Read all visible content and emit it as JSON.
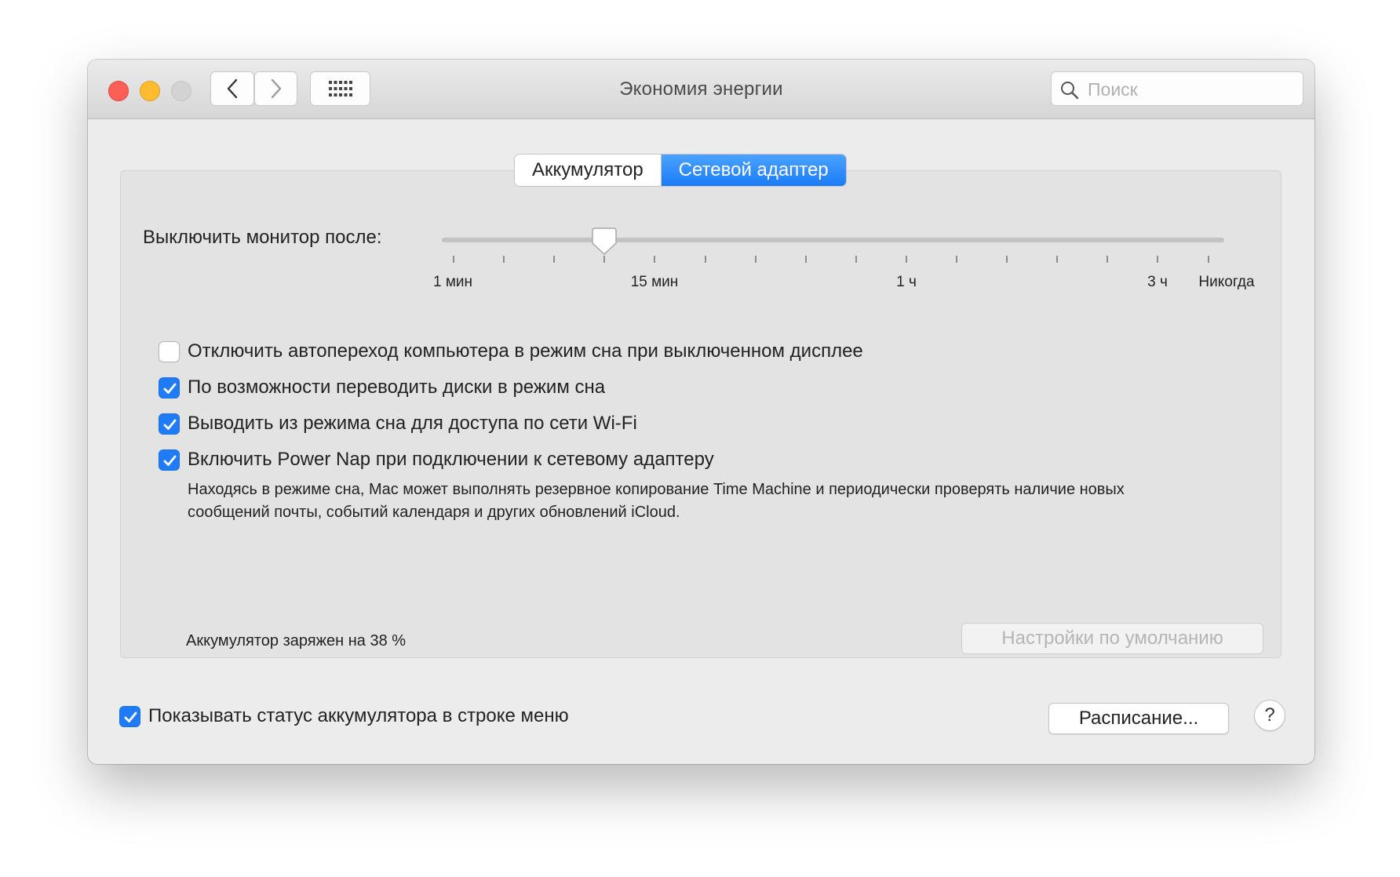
{
  "window": {
    "title": "Экономия энергии",
    "search_placeholder": "Поиск"
  },
  "tabs": [
    {
      "label": "Аккумулятор",
      "active": false
    },
    {
      "label": "Сетевой адаптер",
      "active": true
    }
  ],
  "slider": {
    "label": "Выключить монитор после:",
    "tick_labels": [
      "1 мин",
      "15 мин",
      "1 ч",
      "3 ч",
      "Никогда"
    ],
    "tick_count": 16,
    "value_fraction": 0.21
  },
  "options": [
    {
      "label": "Отключить автопереход компьютера в режим сна при выключенном дисплее",
      "checked": false
    },
    {
      "label": "По возможности переводить диски в режим сна",
      "checked": true
    },
    {
      "label": "Выводить из режима сна для доступа по сети Wi-Fi",
      "checked": true
    },
    {
      "label": "Включить Power Nap при подключении к сетевому адаптеру",
      "checked": true
    }
  ],
  "power_nap_description": "Находясь в режиме сна, Mac может выполнять резервное копирование Time Machine и периодически проверять наличие новых сообщений почты, событий календаря и других обновлений iCloud.",
  "battery_status": "Аккумулятор заряжен на 38 %",
  "restore_defaults_label": "Настройки по умолчанию",
  "show_status": {
    "label": "Показывать статус аккумулятора в строке меню",
    "checked": true
  },
  "schedule_label": "Расписание...",
  "help_label": "?",
  "colors": {
    "accent": "#1f7cf6",
    "close": "#fd5f57",
    "minimize": "#febc2e"
  }
}
